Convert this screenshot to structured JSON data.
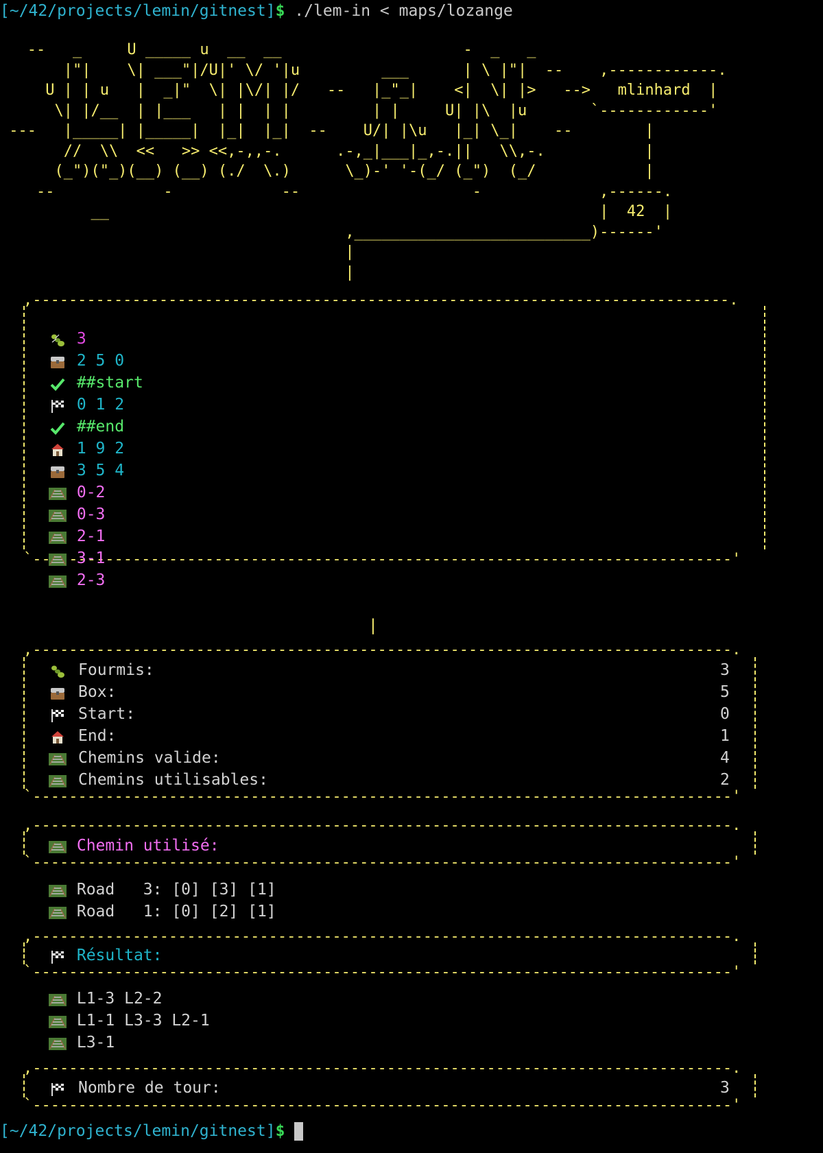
{
  "prompt": {
    "path": "[~/42/projects/lemin/gitnest]",
    "symbol": "$",
    "command": " ./lem-in < maps/lozange"
  },
  "banner": {
    "art": [
      "   --   _     U _____ u  __  __                    -  _   _",
      "       |\"|    \\| ___\"|/U|' \\/ '|u         ___      | \\ |\"|  --    ,------------.",
      "     U | | u   |  _|\"  \\| |\\/| |/   --   |_\"_|    <|  \\| |>   -->   mlinhard  |",
      "      \\| |/__  | |___   | |  | |         | |     U| |\\  |u       `------------'",
      " ---   |_____| |_____|  |_|  |_|  --    U/| |\\u   |_| \\_|    --        |",
      "       //  \\\\  <<   >> <<,-,,-.      .-,_|___|_,-.||   \\\\,-.           |",
      "      (_\")(\"_)(__) (__) (./  \\.)      \\_)-' '-(_/ (_\")  (_/            |",
      "    --            -            --                   -             ,------.",
      "          __                                                      |  42  |",
      "                                      ,__________________________)------'",
      "                                      |",
      "                                      |"
    ]
  },
  "map": {
    "ants": "3",
    "room1": "2 5 0",
    "start_cmd": "##start",
    "start_room": "0 1 2",
    "end_cmd": "##end",
    "end_room": "1 9 2",
    "room2": "3 5 4",
    "links": [
      "0-2",
      "0-3",
      "2-1",
      "3-1",
      "2-3"
    ]
  },
  "stats": {
    "ants_label": "Fourmis:",
    "ants_value": "3",
    "box_label": "Box:",
    "box_value": "5",
    "start_label": "Start:",
    "start_value": "0",
    "end_label": "End:",
    "end_value": "1",
    "valid_label": "Chemins valide:",
    "valid_value": "4",
    "usable_label": "Chemins utilisables:",
    "usable_value": "2"
  },
  "paths": {
    "heading": "Chemin utilisé:",
    "roads": [
      "Road   3: [0] [3] [1]",
      "Road   1: [0] [2] [1]"
    ]
  },
  "result": {
    "heading": "Résultat:",
    "moves": [
      "L1-3 L2-2",
      "L1-1 L3-3 L2-1",
      "L3-1"
    ]
  },
  "turns": {
    "label": "Nombre de tour:",
    "value": "3"
  },
  "box_chars": {
    "top": ",-----------------------------------------------------------------------------.",
    "bottom": "`-----------------------------------------------------------------------------'",
    "connector": "|"
  },
  "colors": {
    "ascii_art": "#f6ec6e",
    "prompt_path": "#2fb3cf",
    "prompt_symbol": "#38d956",
    "numbers": "#1fb5c9",
    "links": "#f26ef2",
    "commands": "#57e86b"
  },
  "icons": [
    "ant-icon",
    "box-icon",
    "checkmark-icon",
    "checkered-flag-icon",
    "house-icon",
    "railway-icon"
  ]
}
